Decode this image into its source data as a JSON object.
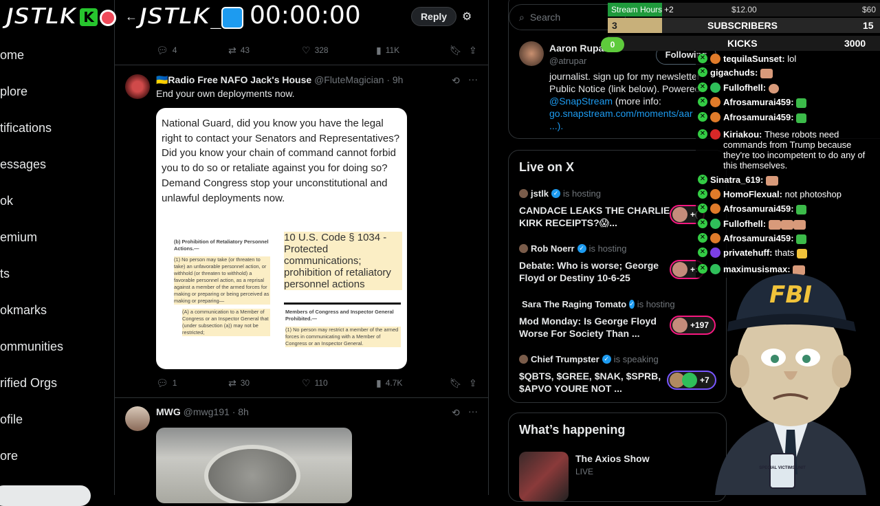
{
  "nav": [
    "ome",
    "plore",
    "tifications",
    "essages",
    "ok",
    "emium",
    "ts",
    "okmarks",
    "ommunities",
    "rified Orgs",
    "ofile",
    "ore"
  ],
  "overlay": {
    "logo1": "JSTLK",
    "logo2": "JSTLK_",
    "timer": "00:00:00"
  },
  "header": {
    "reply_label": "Reply"
  },
  "posts": [
    {
      "actions": {
        "replies": "4",
        "reposts": "43",
        "likes": "328",
        "views": "11K"
      }
    },
    {
      "author": "🇺🇦Radio Free NAFO Jack's House",
      "handle": "@FluteMagician",
      "time": "· 9h",
      "text": "End your own deployments now.",
      "card_text": "National Guard, did you know you have the legal right to contact your Senators and Representatives? Did you know your chain of command cannot forbid you to do so or retaliate against you for doing so? Demand Congress stop your unconstitutional and unlawful deployments now.",
      "doc_left_head": "(b) Prohibition of Retaliatory Personnel Actions.—",
      "doc_left_1": "(1) No person may take (or threaten to take) an unfavorable personnel action, or withhold (or threaten to withhold) a favorable personnel action, as a reprisal against a member of the armed forces for making or preparing or being perceived as making or preparing—",
      "doc_left_2": "(A) a communication to a Member of Congress or an Inspector General that (under subsection (a)) may not be restricted;",
      "doc_right_title": "10 U.S. Code § 1034 - Protected communications; prohibition of retaliatory personnel actions",
      "doc_right_head": "Members of Congress and Inspector General Prohibited.—",
      "doc_right_1": "(1) No person may restrict a member of the armed forces in communicating with a Member of Congress or an Inspector General.",
      "actions": {
        "replies": "1",
        "reposts": "30",
        "likes": "110",
        "views": "4.7K"
      }
    },
    {
      "author": "MWG",
      "handle": "@mwg191",
      "time": "· 8h"
    }
  ],
  "search": {
    "placeholder": "Search"
  },
  "profile": {
    "name": "Aaron Rupar",
    "handle": "@atrupar",
    "follow_label": "Following",
    "bio_1": "journalist. sign up for my newsletter",
    "bio_2": "Public Notice (link below). Powered",
    "bio_3": "@SnapStream",
    "bio_3b": " (more info:",
    "bio_4": "go.snapstream.com/moments/aar",
    "bio_5": "...)."
  },
  "live": {
    "title": "Live on X",
    "items": [
      {
        "host": "jstlk",
        "status": "is hosting",
        "title": "CANDACE LEAKS THE CHARLIE KIRK RECEIPTS?😱...",
        "count": "+("
      },
      {
        "host": "Rob Noerr",
        "status": "is hosting",
        "title": "Debate: Who is worse; George Floyd or Destiny 10-6-25",
        "count": "+:"
      },
      {
        "host": "Sara The Raging Tomato",
        "status": "is hosting",
        "title": "Mod Monday: Is George Floyd Worse For Society Than ...",
        "count": "+197"
      },
      {
        "host": "Chief Trumpster",
        "status": "is speaking",
        "title": "$QBTS, $GREE, $NAK, $SPRB, $APVO YOURE NOT ...",
        "count": "+7"
      }
    ]
  },
  "happening": {
    "title": "What’s happening",
    "item_title": "The Axios Show",
    "item_status": "LIVE"
  },
  "stream": {
    "hours_label": "Stream Hours",
    "hours_delta": "+2",
    "hours_mid": "$12.00",
    "hours_max": "$60",
    "hours_fraction": 0.2,
    "subs_count": "3",
    "subs_label": "SUBSCRIBERS",
    "subs_goal": "15",
    "subs_fraction": 0.2,
    "kicks_count": "0",
    "kicks_label": "KICKS",
    "kicks_goal": "3000",
    "colors": {
      "green": "#1f9a3c",
      "gold": "#c8b07a"
    }
  },
  "chat": [
    {
      "user": "tequilaSunset:",
      "text": "lol",
      "badge": "#e07b2a"
    },
    {
      "user": "gigachuds:",
      "text": "",
      "badge": ""
    },
    {
      "user": "Fullofhell:",
      "text": "",
      "badge": "#2fbf5a"
    },
    {
      "user": "Afrosamurai459:",
      "text": "",
      "badge": "#e07b2a"
    },
    {
      "user": "Afrosamurai459:",
      "text": "",
      "badge": "#e07b2a"
    },
    {
      "user": "Kiriakou:",
      "text": "These robots need commands from Trump because they're too incompetent to do any of this themselves.",
      "badge": "#d62828"
    },
    {
      "user": "Sinatra_619:",
      "text": "",
      "badge": ""
    },
    {
      "user": "HomoFlexual:",
      "text": "not photoshop",
      "badge": "#e07b2a"
    },
    {
      "user": "Afrosamurai459:",
      "text": "",
      "badge": "#e07b2a"
    },
    {
      "user": "Fullofhell:",
      "text": "",
      "badge": "#2fbf5a"
    },
    {
      "user": "Afrosamurai459:",
      "text": "",
      "badge": "#e07b2a"
    },
    {
      "user": "privatehuff:",
      "text": "thats",
      "badge": "#7b3fe4"
    },
    {
      "user": "maximusismax:",
      "text": "",
      "badge": "#2fbf5a"
    }
  ],
  "fbi": {
    "cap_text": "FBI",
    "badge_text": "SPECIAL VICTIMS UNIT"
  }
}
